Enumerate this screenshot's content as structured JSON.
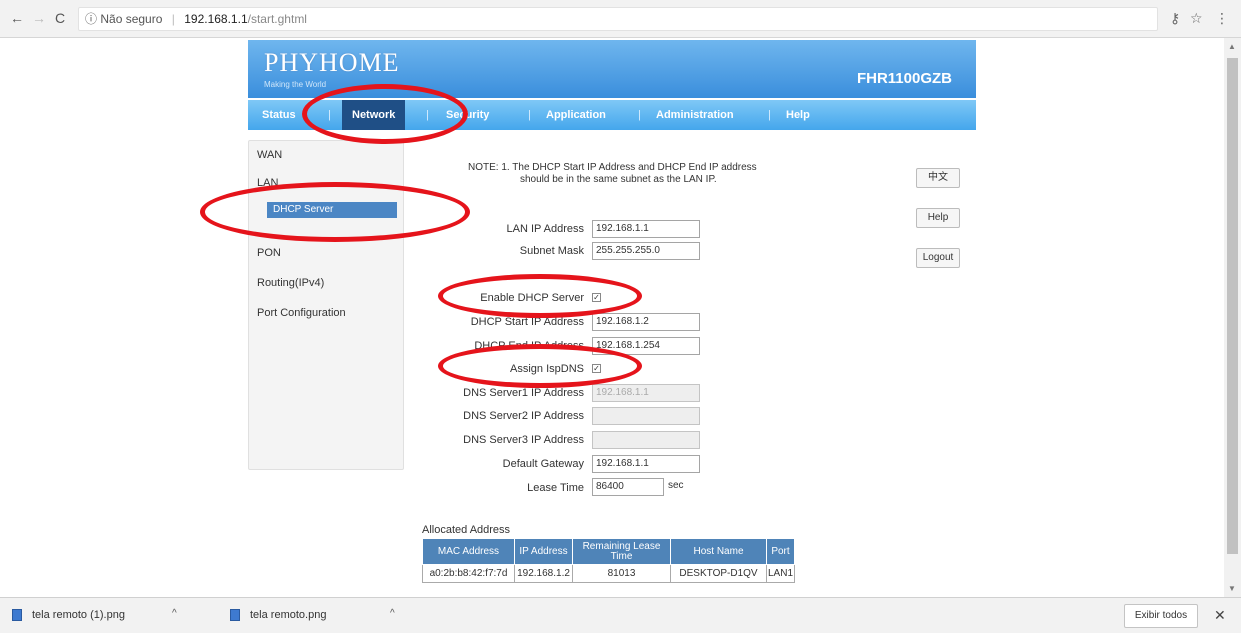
{
  "browser": {
    "security_label": "Não seguro",
    "url_host": "192.168.1.1",
    "url_path": "/start.ghtml"
  },
  "router": {
    "logo": "PHYHOME",
    "tagline": "Making the World",
    "model": "FHR1100GZB",
    "menu": [
      {
        "label": "Status"
      },
      {
        "label": "Network"
      },
      {
        "label": "Security"
      },
      {
        "label": "Application"
      },
      {
        "label": "Administration"
      },
      {
        "label": "Help"
      }
    ],
    "sidebar": {
      "wan": "WAN",
      "lan": "LAN",
      "dhcp_server": "DHCP Server",
      "pon": "PON",
      "routing": "Routing(IPv4)",
      "port_config": "Port Configuration"
    },
    "note_line1": "NOTE: 1. The DHCP Start IP Address and DHCP End IP address",
    "note_line2": "should be in the same subnet as the LAN IP.",
    "buttons": {
      "lang": "中文",
      "help": "Help",
      "logout": "Logout"
    },
    "form": {
      "lan_ip_label": "LAN IP Address",
      "lan_ip_value": "192.168.1.1",
      "subnet_label": "Subnet Mask",
      "subnet_value": "255.255.255.0",
      "enable_dhcp_label": "Enable DHCP Server",
      "dhcp_start_label": "DHCP Start IP Address",
      "dhcp_start_value": "192.168.1.2",
      "dhcp_end_label": "DHCP End IP Address",
      "dhcp_end_value": "192.168.1.254",
      "assign_isp_dns_label": "Assign IspDNS",
      "dns1_label": "DNS Server1 IP Address",
      "dns1_value": "192.168.1.1",
      "dns2_label": "DNS Server2 IP Address",
      "dns2_value": "",
      "dns3_label": "DNS Server3 IP Address",
      "dns3_value": "",
      "gateway_label": "Default Gateway",
      "gateway_value": "192.168.1.1",
      "lease_label": "Lease Time",
      "lease_value": "86400",
      "lease_unit": "sec"
    },
    "allocated": {
      "title": "Allocated Address",
      "headers": [
        "MAC Address",
        "IP Address",
        "Remaining Lease Time",
        "Host Name",
        "Port"
      ],
      "rows": [
        [
          "a0:2b:b8:42:f7:7d",
          "192.168.1.2",
          "81013",
          "DESKTOP-D1QV",
          "LAN1"
        ]
      ]
    }
  },
  "downloads": {
    "items": [
      {
        "name": "tela remoto (1).png"
      },
      {
        "name": "tela remoto.png"
      }
    ],
    "show_all": "Exibir todos"
  },
  "colors": {
    "annotation": "#e5141b",
    "menu_active": "#1f4f86",
    "table_header": "#4f84b8"
  }
}
